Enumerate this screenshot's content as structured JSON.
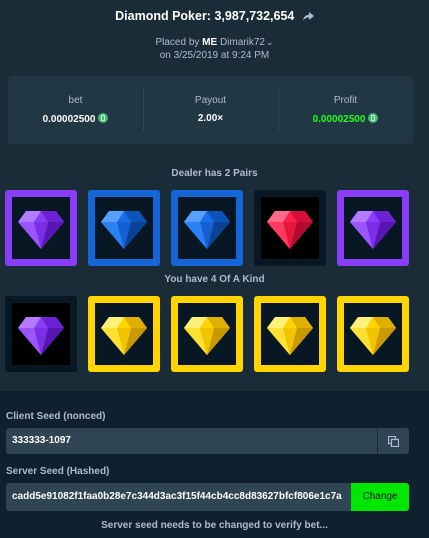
{
  "header": {
    "title": "Diamond Poker: 3,987,732,654",
    "placed_prefix": "Placed by",
    "placed_by_user": "ME",
    "placed_by_name": "Dimarik72",
    "placed_date": "on 3/25/2019 at 9:24 PM"
  },
  "stats": {
    "bet_label": "bet",
    "bet_value": "0.00002500",
    "payout_label": "Payout",
    "payout_value": "2.00×",
    "profit_label": "Profit",
    "profit_value": "0.00002500",
    "profit_color": "#1fff20"
  },
  "dealer": {
    "label": "Dealer has 2 Pairs",
    "cards": [
      {
        "gem": "purple-gem-icon",
        "color": "#8a3df7"
      },
      {
        "gem": "blue-gem-icon",
        "color": "#1565d8"
      },
      {
        "gem": "blue-gem-icon",
        "color": "#1565d8"
      },
      {
        "gem": "red-gem-icon",
        "color": "#ff1f4b"
      },
      {
        "gem": "purple-gem-icon",
        "color": "#8a3df7"
      }
    ]
  },
  "player": {
    "label": "You have 4 Of A Kind",
    "cards": [
      {
        "gem": "purple-gem-icon",
        "color": "#8a3df7"
      },
      {
        "gem": "yellow-gem-icon",
        "color": "#ffd400"
      },
      {
        "gem": "yellow-gem-icon",
        "color": "#ffd400"
      },
      {
        "gem": "yellow-gem-icon",
        "color": "#ffd400"
      },
      {
        "gem": "yellow-gem-icon",
        "color": "#ffd400"
      }
    ]
  },
  "seeds": {
    "client_label": "Client Seed (nonced)",
    "client_value": "333333-1097",
    "server_label": "Server Seed (Hashed)",
    "server_value": "cadd5e91082f1faa0b28e7c344d3ac3f15f44cb4cc8d83627bfcf806e1c7a",
    "change_label": "Change",
    "note": "Server seed needs to be changed to verify bet..."
  },
  "colors": {
    "background": "#1a2c38",
    "panel": "#213743",
    "accent_green": "#00e701"
  }
}
